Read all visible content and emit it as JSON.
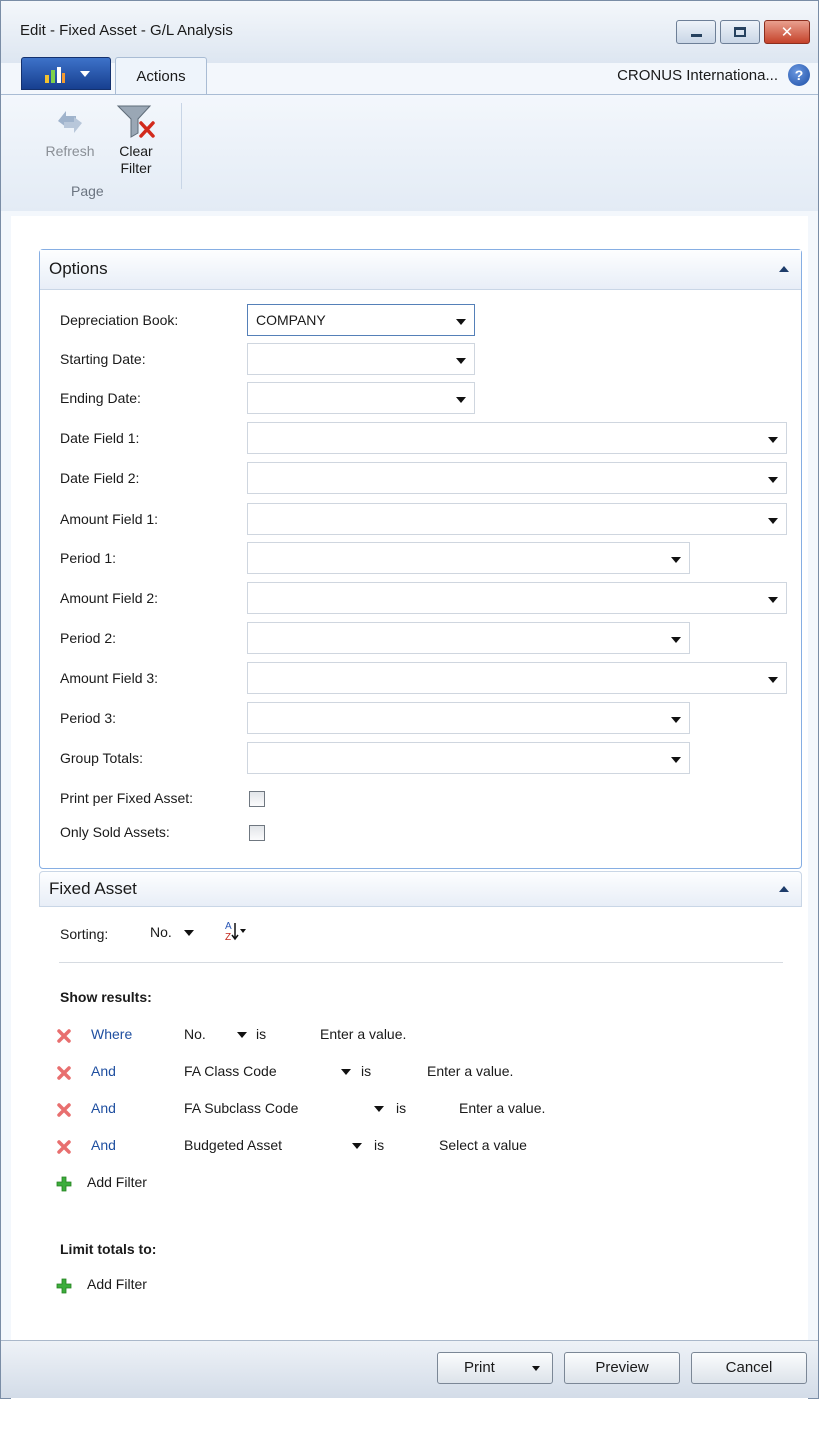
{
  "window": {
    "title": "Edit - Fixed Asset - G/L Analysis"
  },
  "ribbon": {
    "tab_label": "Actions",
    "company": "CRONUS Internationa...",
    "refresh_label": "Refresh",
    "clear_filter_label_1": "Clear",
    "clear_filter_label_2": "Filter",
    "group_label": "Page"
  },
  "options": {
    "header": "Options",
    "fields": {
      "depreciation_book": {
        "label": "Depreciation Book:",
        "value": "COMPANY"
      },
      "starting_date": {
        "label": "Starting Date:",
        "value": ""
      },
      "ending_date": {
        "label": "Ending Date:",
        "value": ""
      },
      "date_field_1": {
        "label": "Date Field 1:",
        "value": ""
      },
      "date_field_2": {
        "label": "Date Field 2:",
        "value": ""
      },
      "amount_field_1": {
        "label": "Amount Field 1:",
        "value": ""
      },
      "period_1": {
        "label": "Period 1:",
        "value": ""
      },
      "amount_field_2": {
        "label": "Amount Field 2:",
        "value": ""
      },
      "period_2": {
        "label": "Period 2:",
        "value": ""
      },
      "amount_field_3": {
        "label": "Amount Field 3:",
        "value": ""
      },
      "period_3": {
        "label": "Period 3:",
        "value": ""
      },
      "group_totals": {
        "label": "Group Totals:",
        "value": ""
      },
      "print_per_fixed_asset": {
        "label": "Print per Fixed Asset:",
        "checked": false
      },
      "only_sold_assets": {
        "label": "Only Sold Assets:",
        "checked": false
      }
    }
  },
  "fixed_asset": {
    "header": "Fixed Asset",
    "sorting_label": "Sorting:",
    "sorting_value": "No.",
    "show_results_label": "Show results:",
    "filters": [
      {
        "conj": "Where",
        "field": "No.",
        "op": "is",
        "value": "Enter a value."
      },
      {
        "conj": "And",
        "field": "FA Class Code",
        "op": "is",
        "value": "Enter a value."
      },
      {
        "conj": "And",
        "field": "FA Subclass Code",
        "op": "is",
        "value": "Enter a value."
      },
      {
        "conj": "And",
        "field": "Budgeted Asset",
        "op": "is",
        "value": "Select a value"
      }
    ],
    "add_filter_label": "Add Filter",
    "limit_totals_label": "Limit totals to:",
    "limit_add_filter_label": "Add Filter"
  },
  "buttons": {
    "print": "Print",
    "preview": "Preview",
    "cancel": "Cancel"
  }
}
